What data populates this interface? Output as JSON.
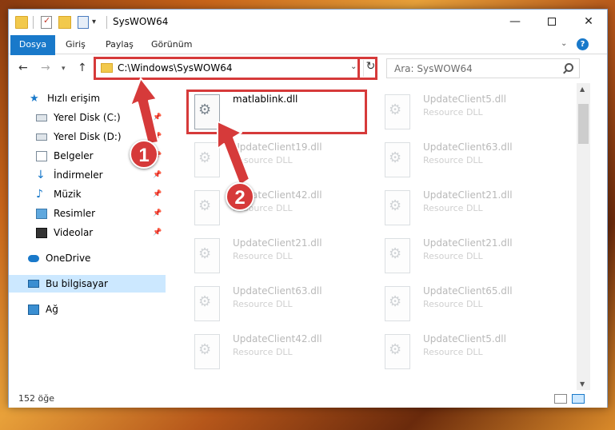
{
  "window": {
    "title": "SysWOW64"
  },
  "ribbon": {
    "file_tab": "Dosya",
    "tabs": [
      "Giriş",
      "Paylaş",
      "Görünüm"
    ]
  },
  "address": {
    "path": "C:\\Windows\\SysWOW64"
  },
  "search": {
    "placeholder": "Ara: SysWOW64"
  },
  "navpane": {
    "items": [
      {
        "label": "Hızlı erişim",
        "icon": "star-icon",
        "pinned": false
      },
      {
        "label": "Yerel Disk (C:)",
        "icon": "drive-icon",
        "pinned": true
      },
      {
        "label": "Yerel Disk (D:)",
        "icon": "drive-icon",
        "pinned": true
      },
      {
        "label": "Belgeler",
        "icon": "documents-icon",
        "pinned": true
      },
      {
        "label": "İndirmeler",
        "icon": "download-icon",
        "pinned": true
      },
      {
        "label": "Müzik",
        "icon": "music-icon",
        "pinned": true
      },
      {
        "label": "Resimler",
        "icon": "pictures-icon",
        "pinned": true
      },
      {
        "label": "Videolar",
        "icon": "video-icon",
        "pinned": true
      },
      {
        "label": "OneDrive",
        "icon": "cloud-icon",
        "pinned": false
      },
      {
        "label": "Bu bilgisayar",
        "icon": "computer-icon",
        "pinned": false,
        "selected": true
      },
      {
        "label": "Ağ",
        "icon": "network-icon",
        "pinned": false
      }
    ]
  },
  "files": {
    "highlighted": {
      "name": "matlablink.dll"
    },
    "faded": [
      {
        "name": "UpdateClient5.dll",
        "type": "Resource DLL"
      },
      {
        "name": "UpdateClient19.dll",
        "type": "Resource DLL"
      },
      {
        "name": "UpdateClient63.dll",
        "type": "Resource DLL"
      },
      {
        "name": "UpdateClient42.dll",
        "type": "Resource DLL"
      },
      {
        "name": "UpdateClient21.dll",
        "type": "Resource DLL"
      },
      {
        "name": "UpdateClient21.dll",
        "type": "Resource DLL"
      },
      {
        "name": "UpdateClient21.dll",
        "type": "Resource DLL"
      },
      {
        "name": "UpdateClient63.dll",
        "type": "Resource DLL"
      },
      {
        "name": "UpdateClient65.dll",
        "type": "Resource DLL"
      },
      {
        "name": "UpdateClient42.dll",
        "type": "Resource DLL"
      },
      {
        "name": "UpdateClient5.dll",
        "type": "Resource DLL"
      }
    ]
  },
  "status": {
    "item_count": "152 öğe"
  },
  "callouts": {
    "one": "1",
    "two": "2"
  },
  "colors": {
    "accent": "#1979ca",
    "highlight": "#d63a3a",
    "selected_bg": "#cce8ff"
  }
}
